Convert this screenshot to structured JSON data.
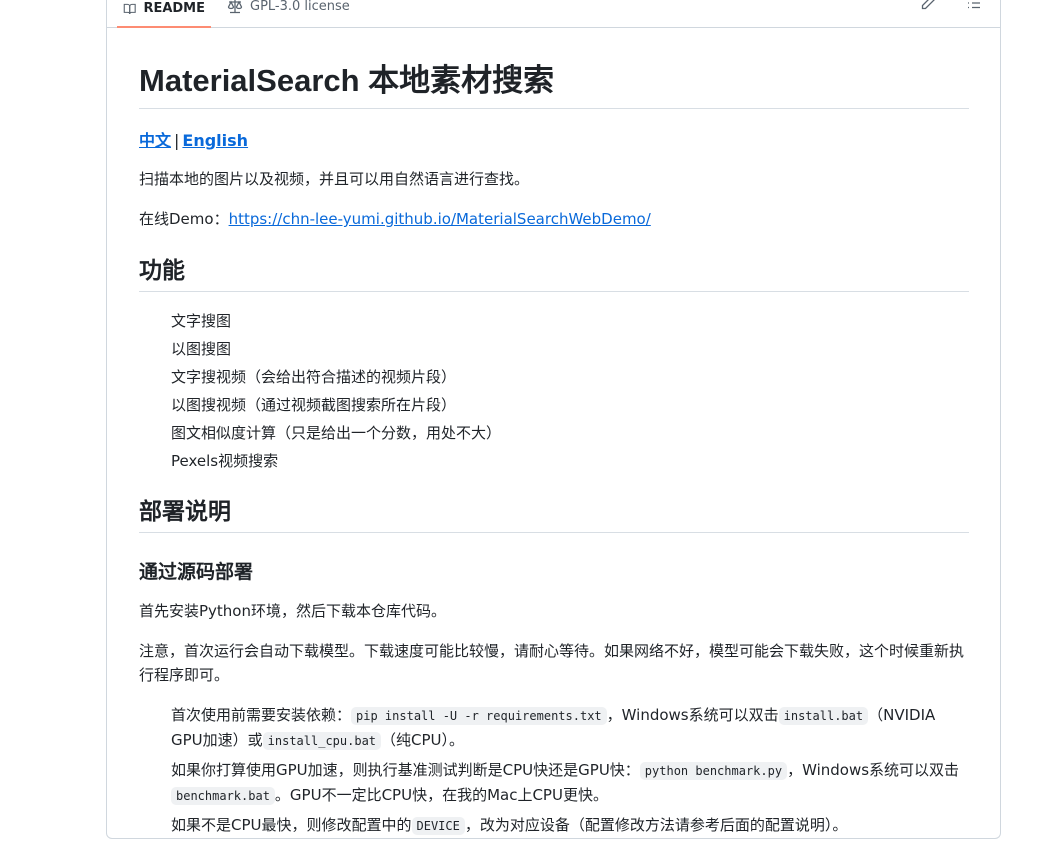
{
  "tabs": {
    "readme": "README",
    "license": "GPL-3.0 license"
  },
  "doc": {
    "title": "MaterialSearch 本地素材搜索",
    "lang_zh": "中文",
    "lang_sep": "|",
    "lang_en": "English",
    "intro": "扫描本地的图片以及视频，并且可以用自然语言进行查找。",
    "demo_label": "在线Demo：",
    "demo_url": "https://chn-lee-yumi.github.io/MaterialSearchWebDemo/",
    "features_heading": "功能",
    "features": [
      "文字搜图",
      "以图搜图",
      "文字搜视频（会给出符合描述的视频片段）",
      "以图搜视频（通过视频截图搜索所在片段）",
      "图文相似度计算（只是给出一个分数，用处不大）",
      "Pexels视频搜索"
    ],
    "deploy_heading": "部署说明",
    "source_heading": "通过源码部署",
    "source_p1": "首先安装Python环境，然后下载本仓库代码。",
    "source_p2": "注意，首次运行会自动下载模型。下载速度可能比较慢，请耐心等待。如果网络不好，模型可能会下载失败，这个时候重新执行程序即可。",
    "steps": {
      "s1_a": "首次使用前需要安装依赖：",
      "s1_code1": "pip install -U -r requirements.txt",
      "s1_b": "，Windows系统可以双击",
      "s1_code2": "install.bat",
      "s1_c": "（NVIDIA GPU加速）或",
      "s1_code3": "install_cpu.bat",
      "s1_d": "（纯CPU）。",
      "s2_a": "如果你打算使用GPU加速，则执行基准测试判断是CPU快还是GPU快：",
      "s2_code1": "python benchmark.py",
      "s2_b": "，Windows系统可以双击",
      "s2_code2": "benchmark.bat",
      "s2_c": "。GPU不一定比CPU快，在我的Mac上CPU更快。",
      "s3_a": "如果不是CPU最快，则修改配置中的",
      "s3_code1": "DEVICE",
      "s3_b": "，改为对应设备（配置修改方法请参考后面的配置说明）。"
    }
  },
  "icons": {
    "readme": "book-icon",
    "license": "law-icon",
    "edit": "pencil-icon",
    "outline": "list-icon"
  }
}
